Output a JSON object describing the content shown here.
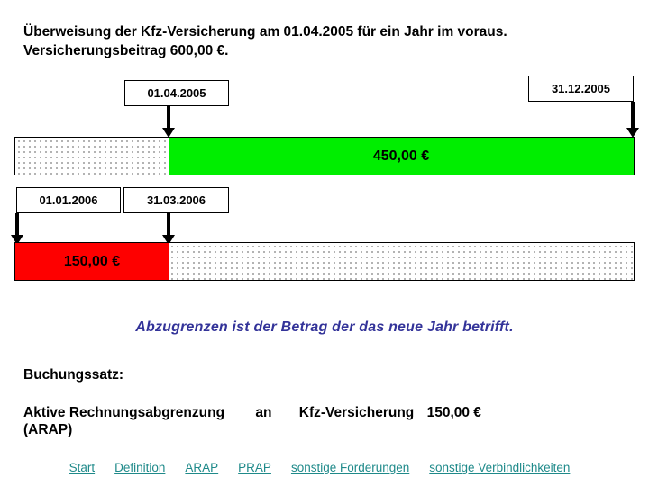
{
  "title": "Überweisung der Kfz-Versicherung am 01.04.2005 für ein Jahr im voraus. Versicherungsbeitrag 600,00 €.",
  "timeline": {
    "labels": {
      "start_2005": "01.04.2005",
      "end_2005": "31.12.2005",
      "start_2006": "01.01.2006",
      "end_2006": "31.03.2006"
    },
    "bar_2005": {
      "left_segment_value": "",
      "right_segment_value": "450,00 €",
      "right_segment_color": "#00ee00"
    },
    "bar_2006": {
      "left_segment_value": "150,00 €",
      "left_segment_color": "#fe0000",
      "right_segment_value": ""
    }
  },
  "callout": {
    "text": "Abzugrenzen ist der Betrag der das neue Jahr betrifft.",
    "color": "#333399"
  },
  "booking": {
    "heading": "Buchungssatz:",
    "soll_account": "Aktive Rechnungsabgrenzung",
    "soll_account_abbrev": "(ARAP)",
    "connector": "an",
    "haben_account": "Kfz-Versicherung",
    "amount": "150,00 €"
  },
  "footer": {
    "link_color": "#1f8a8a",
    "links": [
      {
        "label": "Start"
      },
      {
        "label": "Definition"
      },
      {
        "label": "ARAP"
      },
      {
        "label": "PRAP"
      },
      {
        "label": "sonstige Forderungen"
      },
      {
        "label": "sonstige Verbindlichkeiten"
      }
    ]
  }
}
